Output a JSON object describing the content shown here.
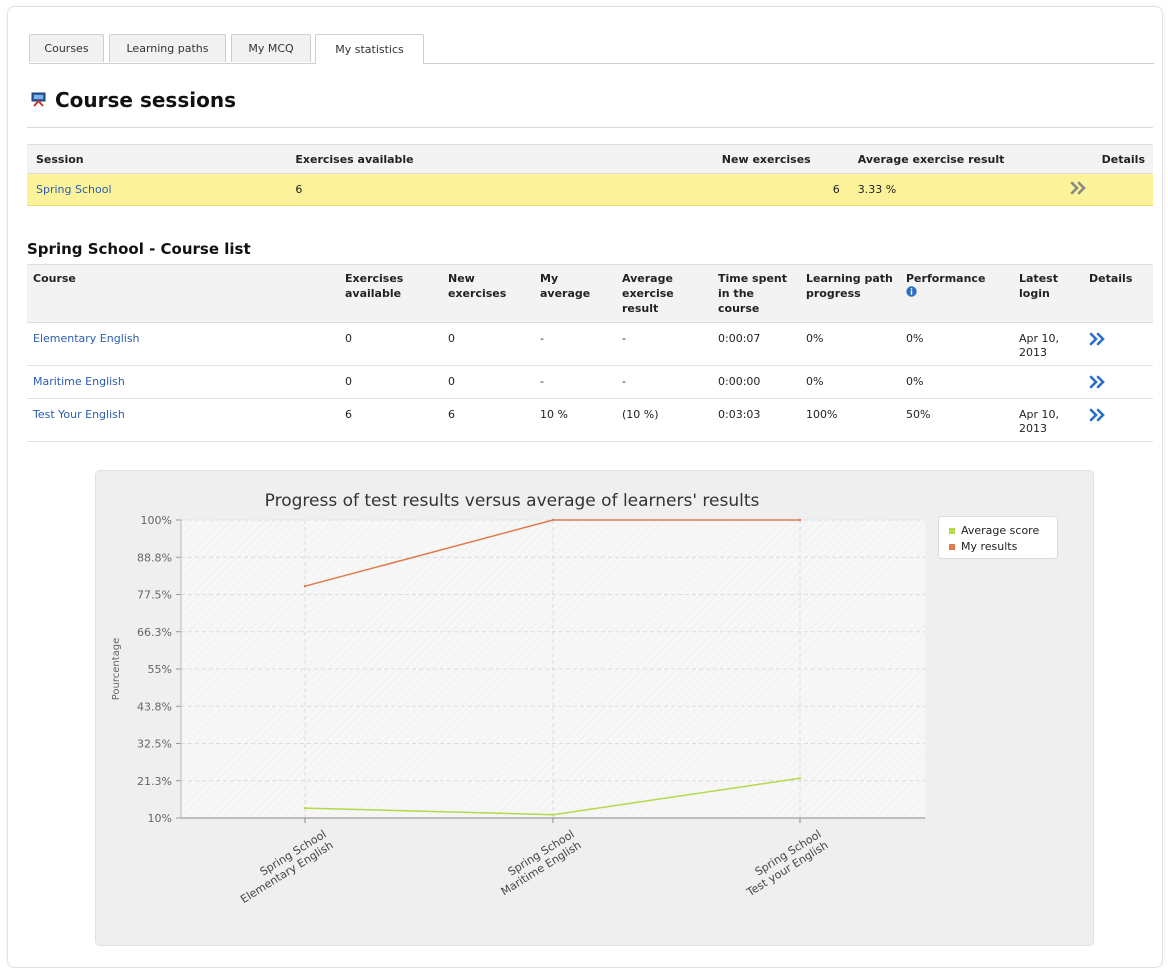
{
  "tabs": [
    "Courses",
    "Learning paths",
    "My MCQ",
    "My statistics"
  ],
  "page_title": "Course sessions",
  "sessions_table": {
    "headers": [
      "Session",
      "Exercises available",
      "New exercises",
      "Average exercise result",
      "Details"
    ],
    "rows": [
      {
        "session": "Spring School",
        "exercises_available": "6",
        "new_exercises": "6",
        "average_result": "3.33 %"
      }
    ]
  },
  "course_list": {
    "title": "Spring School - Course list",
    "headers": {
      "course": "Course",
      "exercises_available": "Exercises available",
      "new_exercises": "New exercises",
      "my_average": "My average",
      "average_result": "Average exercise result",
      "time_spent": "Time spent in the course",
      "lp_progress": "Learning path progress",
      "performance": "Performance",
      "latest_login": "Latest login",
      "details": "Details"
    },
    "rows": [
      {
        "course": "Elementary English",
        "exercises": "0",
        "new": "0",
        "my_avg": "-",
        "avg_result": "-",
        "time": "0:00:07",
        "lp": "0%",
        "performance": "0%",
        "login": "Apr 10, 2013"
      },
      {
        "course": "Maritime English",
        "exercises": "0",
        "new": "0",
        "my_avg": "-",
        "avg_result": "-",
        "time": "0:00:00",
        "lp": "0%",
        "performance": "0%",
        "login": ""
      },
      {
        "course": "Test Your English",
        "exercises": "6",
        "new": "6",
        "my_avg": "10 %",
        "avg_result": "(10 %)",
        "time": "0:03:03",
        "lp": "100%",
        "performance": "50%",
        "login": "Apr 10, 2013"
      }
    ]
  },
  "icons": {
    "course_sessions": "course-sessions-icon",
    "details": "double-chevron-right-icon",
    "performance_info": "info-icon"
  },
  "colors": {
    "session_row": "#fbf29a",
    "link": "#2a5db0",
    "average_score": "#b5d94a",
    "my_results": "#e07a4b"
  },
  "chart_data": {
    "type": "line",
    "title": "Progress of test results versus average of learners' results",
    "ylabel": "Pourcentage",
    "xlabel": "",
    "categories": [
      "Spring School Elementary English",
      "Spring School Maritime English",
      "Spring School Test your English"
    ],
    "category_lines": [
      [
        "Spring School",
        "Elementary English"
      ],
      [
        "Spring School",
        "Maritime English"
      ],
      [
        "Spring School",
        "Test your English"
      ]
    ],
    "yticks": [
      "10%",
      "21.3%",
      "32.5%",
      "43.8%",
      "55%",
      "66.3%",
      "77.5%",
      "88.8%",
      "100%"
    ],
    "ylim": [
      10,
      100
    ],
    "series": [
      {
        "name": "Average score",
        "color": "#b5d94a",
        "values": [
          13,
          11,
          22
        ]
      },
      {
        "name": "My results",
        "color": "#e07a4b",
        "values": [
          80,
          100,
          100
        ]
      }
    ],
    "legend": "top-right",
    "grid": true
  }
}
